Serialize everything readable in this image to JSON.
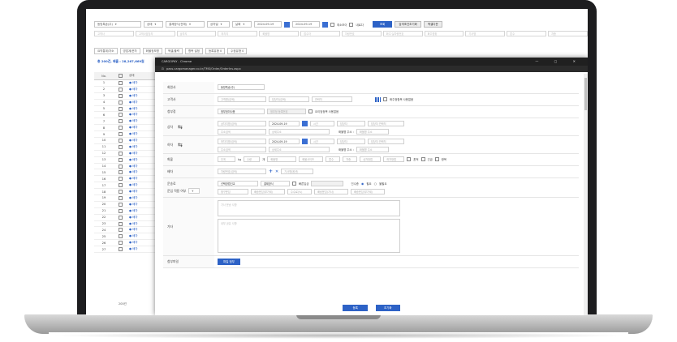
{
  "toolbar": {
    "company": "동방특송(주)",
    "status": "상태",
    "payment": "결제방식(전체)",
    "date_type": "상차일",
    "period": "날짜",
    "date_from": "2024-09-19",
    "date_to": "2024-09-19",
    "chk_recent": "최소모이",
    "chk_next": "내로다",
    "search_btn": "조회",
    "reset_btn": "검색조건초기화",
    "excel_btn": "엑셀다운"
  },
  "filters": [
    "고객사",
    "고객사담당자",
    "상차지",
    "하차지",
    "화물명",
    "접수자",
    "차량번호",
    "화주·실차량번호",
    "화주명찾",
    "기사명",
    "톤수",
    "차종"
  ],
  "row3": [
    "요약통계/차소",
    "영업계/운차",
    "화물정보명",
    "엑셀/출력",
    "항목 설정",
    "등록유형 0",
    "수정유형 0"
  ],
  "summary": "총 200건, 배출 : 28,267,669원",
  "grid": {
    "headers": [
      "No.",
      "",
      "상태"
    ],
    "status_label": "배차",
    "rows": [
      "1",
      "2",
      "3",
      "4",
      "5",
      "6",
      "7",
      "8",
      "9",
      "10",
      "11",
      "12",
      "13",
      "14",
      "15",
      "16",
      "17",
      "18",
      "19",
      "20",
      "21",
      "22",
      "23",
      "24",
      "25",
      "26",
      "27"
    ],
    "footer": "200건"
  },
  "popup": {
    "title": "CARGOPAY - Chrome",
    "url": "pass.cargomanager.co.kr/TMS/Order/OrderIns.aspx",
    "labels": {
      "company": "회원사",
      "customer": "고객사",
      "pay": "청부정",
      "load": "상차",
      "unload": "하차",
      "cargo": "화물",
      "dispatch": "배차",
      "fare": "운송료",
      "fare_sub": "운임 적용 여부",
      "etc": "기타",
      "attach": "첨부파일"
    },
    "company_value": "동방특송(주)",
    "customer_ph": [
      "고객명(검색)",
      "담당자(검색)",
      "연락처"
    ],
    "customer_chk": "화주정합목 사용없음",
    "pay_value": "청부정미사용",
    "pay_ph": "청부정 등록번호",
    "pay_chk": "요이엄정목 사용없음",
    "load_ph": [
      "상차지명(검색)",
      "시간",
      "담당자",
      "담당자 연락처",
      "주소검색",
      "상세주소",
      "화물명 주소 :",
      "화물명 주소"
    ],
    "load_date": "2024-09-19",
    "unload_ph": [
      "하차지명(검색)",
      "시간",
      "담당자",
      "담당자 연락처",
      "주소검색",
      "상세주소",
      "화물명 주소 :",
      "화물명 주소"
    ],
    "unload_date": "2024-09-19",
    "cargo_fields": [
      "무게",
      "kg",
      "수량",
      "개",
      "화물명",
      "화물사이즈",
      "톤수",
      "차종",
      "상차방법",
      "하차방법",
      "혼적",
      "긴급",
      "왕복"
    ],
    "dispatch_ph": [
      "차량번호(검색)",
      "기사명(옵션)"
    ],
    "fare_method": "선택방법선교",
    "fare_pay": "결제방식",
    "fare_chk": "빠른입금",
    "fare_ph": [
      "청구운임",
      "배송운임(부가세)",
      "수수료(%)",
      "배송운임(기사)",
      "배송운임(부가세)"
    ],
    "fare_sub_value": "Y",
    "fare_radio_label": "인수증",
    "fare_radio1": "필요",
    "fare_radio2": "불필요",
    "etc_ph1": "기사 운송 사항",
    "etc_ph2": "내부 공유 사항",
    "attach_btn": "파일 첨부",
    "save_btn": "등록",
    "reset_btn": "초기화"
  }
}
